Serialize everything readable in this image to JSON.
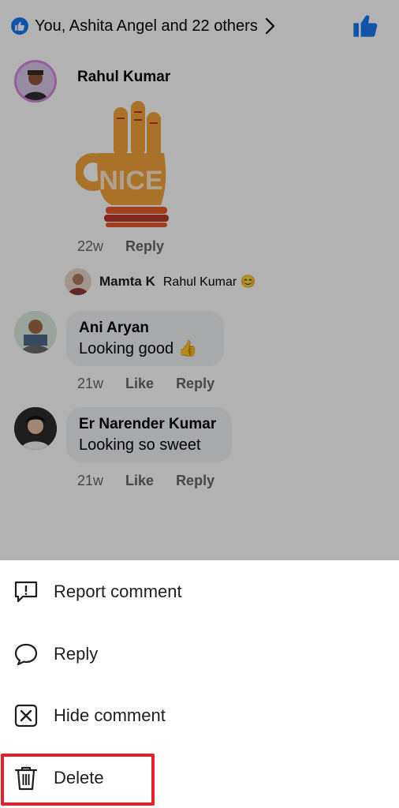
{
  "reactions": {
    "text": "You, Ashita Angel and 22 others"
  },
  "comments": [
    {
      "author": "Rahul Kumar",
      "time": "22w",
      "reply_label": "Reply",
      "sticker_text": "NICE"
    },
    {
      "author": "Ani Aryan",
      "text": "Looking good 👍",
      "time": "21w",
      "like_label": "Like",
      "reply_label": "Reply"
    },
    {
      "author": "Er Narender Kumar",
      "text": "Looking so sweet",
      "time": "21w",
      "like_label": "Like",
      "reply_label": "Reply"
    }
  ],
  "reply_preview": {
    "author": "Mamta K",
    "text": "Rahul Kumar 😊"
  },
  "menu": {
    "items": [
      {
        "label": "Report comment",
        "icon": "report-icon"
      },
      {
        "label": "Reply",
        "icon": "speech-bubble-icon"
      },
      {
        "label": "Hide comment",
        "icon": "hide-box-icon"
      },
      {
        "label": "Delete",
        "icon": "trash-icon"
      }
    ]
  },
  "colors": {
    "brand": "#1877f2",
    "highlight": "#e7202a",
    "overlay": "rgba(0,0,0,0.30)"
  }
}
